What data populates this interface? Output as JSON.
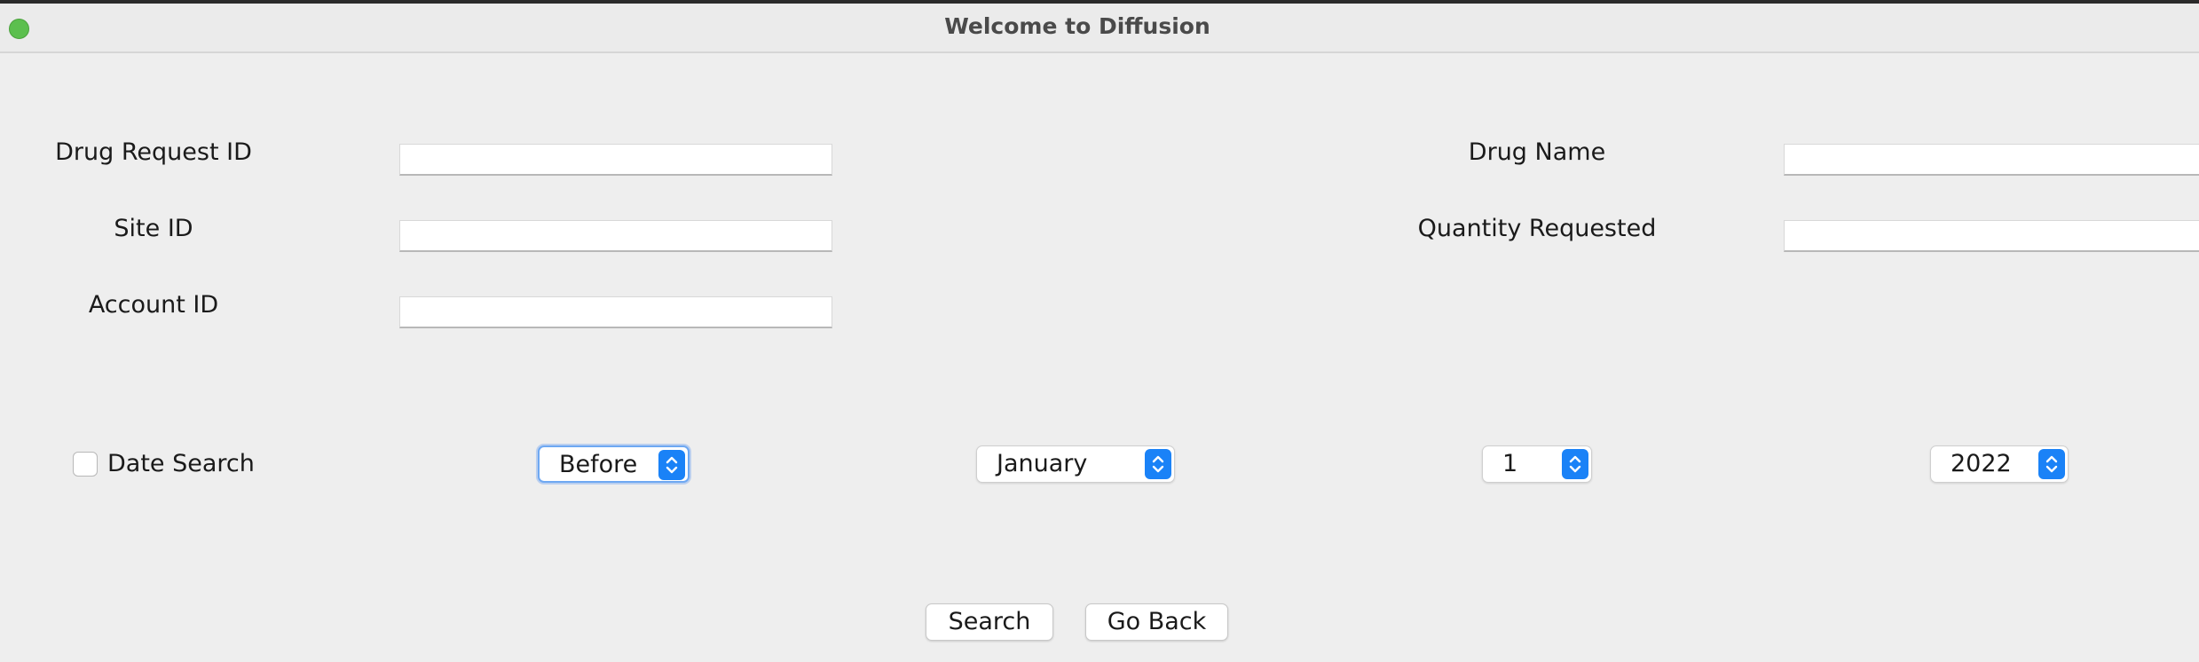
{
  "window": {
    "title": "Welcome to Diffusion"
  },
  "form": {
    "drug_request_id": {
      "label": "Drug Request ID",
      "value": ""
    },
    "site_id": {
      "label": "Site ID",
      "value": ""
    },
    "account_id": {
      "label": "Account ID",
      "value": ""
    },
    "drug_name": {
      "label": "Drug Name",
      "value": ""
    },
    "quantity_requested": {
      "label": "Quantity Requested",
      "value": ""
    }
  },
  "date_search": {
    "label": "Date Search",
    "checked": false,
    "comparison": {
      "selected": "Before"
    },
    "month": {
      "selected": "January"
    },
    "day": {
      "selected": "1"
    },
    "year": {
      "selected": "2022"
    }
  },
  "actions": {
    "search_label": "Search",
    "go_back_label": "Go Back"
  },
  "colors": {
    "accent": "#1a82f7",
    "window_close": "#5cbf4e"
  }
}
